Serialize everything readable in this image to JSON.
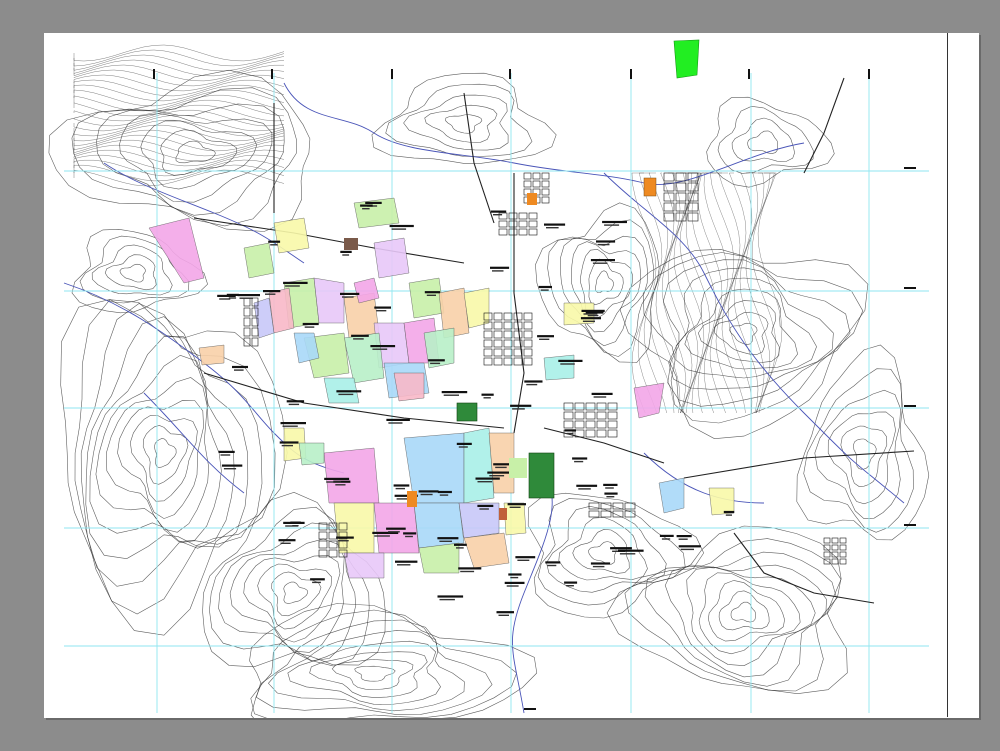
{
  "viewer": {
    "background": "#8c8c8c",
    "paper": "#ffffff"
  },
  "map": {
    "grid_color": "#8fe6f0",
    "contour_color": "#2a2a2a",
    "river_color": "#4a55b8",
    "road_color": "#222222",
    "zone_colors": [
      "#f3a6e8",
      "#c8f0a8",
      "#a8d8f8",
      "#f8d0a8",
      "#e8c8f8",
      "#f8f8a8",
      "#b8f0c8",
      "#f8b8c8",
      "#c8c8f8",
      "#a8f0e8"
    ],
    "special_colors": {
      "park": "#2f8a3a",
      "bright_green": "#22ee22",
      "orange": "#ee8a22"
    }
  }
}
